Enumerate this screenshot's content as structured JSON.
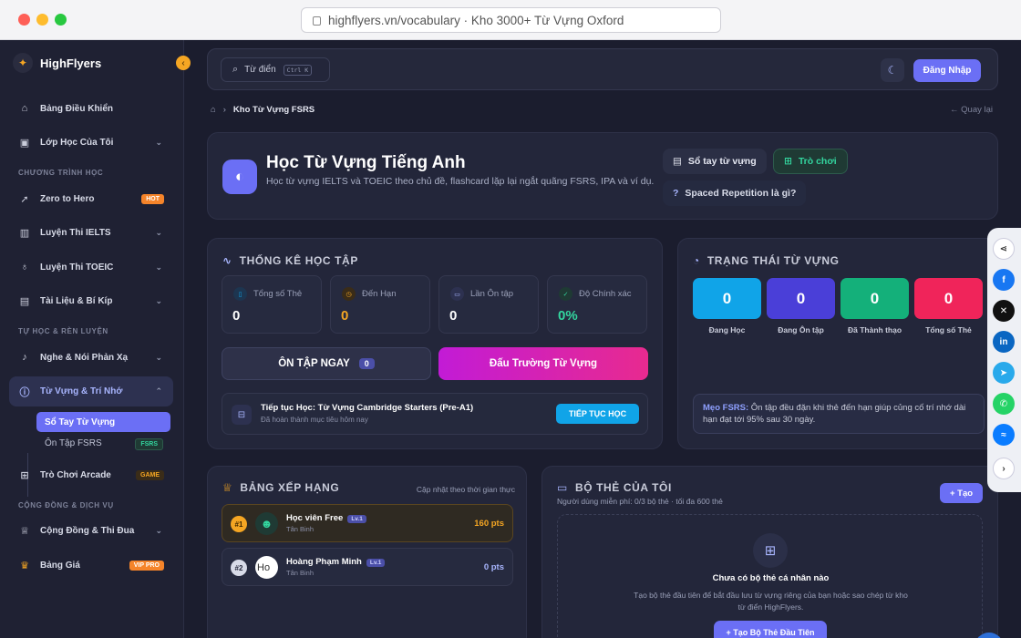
{
  "browser": {
    "url": "highflyers.vn/vocabulary · Kho 3000+ Từ Vựng Oxford"
  },
  "sidebar": {
    "brand": "HighFlyers",
    "items": {
      "dashboard": "Bảng Điều Khiển",
      "classes": "Lớp Học Của Tôi",
      "section_program": "CHƯƠNG TRÌNH HỌC",
      "zero": "Zero to Hero",
      "zero_badge": "HOT",
      "ielts": "Luyện Thi IELTS",
      "toeic": "Luyện Thi TOEIC",
      "docs": "Tài Liệu & Bí Kíp",
      "section_self": "TỰ HỌC & RÈN LUYỆN",
      "speaking": "Nghe & Nói Phản Xạ",
      "vocab": "Từ Vựng & Trí Nhớ",
      "notebook": "Sổ Tay Từ Vựng",
      "fsrs": "Ôn Tập FSRS",
      "fsrs_badge": "FSRS",
      "arcade": "Trò Chơi Arcade",
      "arcade_badge": "GAME",
      "section_comm": "CỘNG ĐỒNG & DỊCH VỤ",
      "community": "Cộng Đồng & Thi Đua",
      "pricing": "Bảng Giá",
      "pricing_badge": "VIP PRO"
    }
  },
  "topbar": {
    "search": "Từ điển",
    "kbd": "Ctrl K",
    "login": "Đăng Nhập"
  },
  "breadcrumb": {
    "current": "Kho Từ Vựng FSRS",
    "back": "Quay lại"
  },
  "hero": {
    "title": "Học Từ Vựng Tiếng Anh",
    "desc": "Học từ vựng IELTS và TOEIC theo chủ đề, flashcard lặp lại ngắt quãng FSRS, IPA và ví dụ.",
    "notebook": "Sổ tay từ vựng",
    "games": "Trò chơi",
    "sr": "Spaced Repetition là gì?"
  },
  "stats": {
    "title": "THỐNG KÊ HỌC TẬP",
    "cards": [
      {
        "label": "Tổng số Thẻ",
        "value": "0"
      },
      {
        "label": "Đến Hạn",
        "value": "0"
      },
      {
        "label": "Lần Ôn tập",
        "value": "0"
      },
      {
        "label": "Độ Chính xác",
        "value": "0%"
      }
    ],
    "review": "ÔN TẬP NGAY",
    "review_count": "0",
    "arena": "Đấu Trường Từ Vựng",
    "continue_title": "Tiếp tục Học: Từ Vựng Cambridge Starters (Pre-A1)",
    "continue_sub": "Đã hoàn thành mục tiêu hôm nay",
    "continue_btn": "TIẾP TỤC HỌC"
  },
  "status": {
    "title": "TRẠNG THÁI TỪ VỰNG",
    "tiles": [
      {
        "value": "0",
        "label": "Đang Học"
      },
      {
        "value": "0",
        "label": "Đang Ôn tập"
      },
      {
        "value": "0",
        "label": "Đã Thành thạo"
      },
      {
        "value": "0",
        "label": "Tổng số Thẻ"
      }
    ],
    "tip_label": "Mẹo FSRS:",
    "tip": "Ôn tập đều đặn khi thẻ đến hạn giúp củng cố trí nhớ dài hạn đạt tới 95% sau 30 ngày."
  },
  "leaderboard": {
    "title": "BẢNG XẾP HẠNG",
    "updated": "Cập nhật theo thời gian thực",
    "rows": [
      {
        "rank": "#1",
        "name": "Học viên Free",
        "level": "Lv.1",
        "sub": "Tân Binh",
        "pts": "160 pts"
      },
      {
        "rank": "#2",
        "name": "Hoàng Phạm Minh",
        "level": "Lv.1",
        "sub": "Tân Binh",
        "pts": "0 pts",
        "avatar_text": "Ho"
      }
    ]
  },
  "decks": {
    "title": "BỘ THẺ CỦA TÔI",
    "sub": "Người dùng miễn phí: 0/3 bộ thẻ · tối đa 600 thẻ",
    "create": "+ Tạo",
    "empty_title": "Chưa có bộ thẻ cá nhân nào",
    "empty_desc": "Tạo bộ thẻ đầu tiên để bắt đầu lưu từ vựng riêng của bạn hoặc sao chép từ kho từ điển HighFlyers.",
    "empty_btn": "+ Tạo Bộ Thẻ Đầu Tiên"
  },
  "colors": {
    "accent": "#6b6ff5",
    "pink": "#e23aa8",
    "cyan": "#10a4e8",
    "gold": "#f5a623"
  },
  "share_icons": [
    "share-icon",
    "facebook-icon",
    "x-icon",
    "linkedin-icon",
    "telegram-icon",
    "whatsapp-icon",
    "messenger-icon",
    "chevron-right-icon"
  ]
}
